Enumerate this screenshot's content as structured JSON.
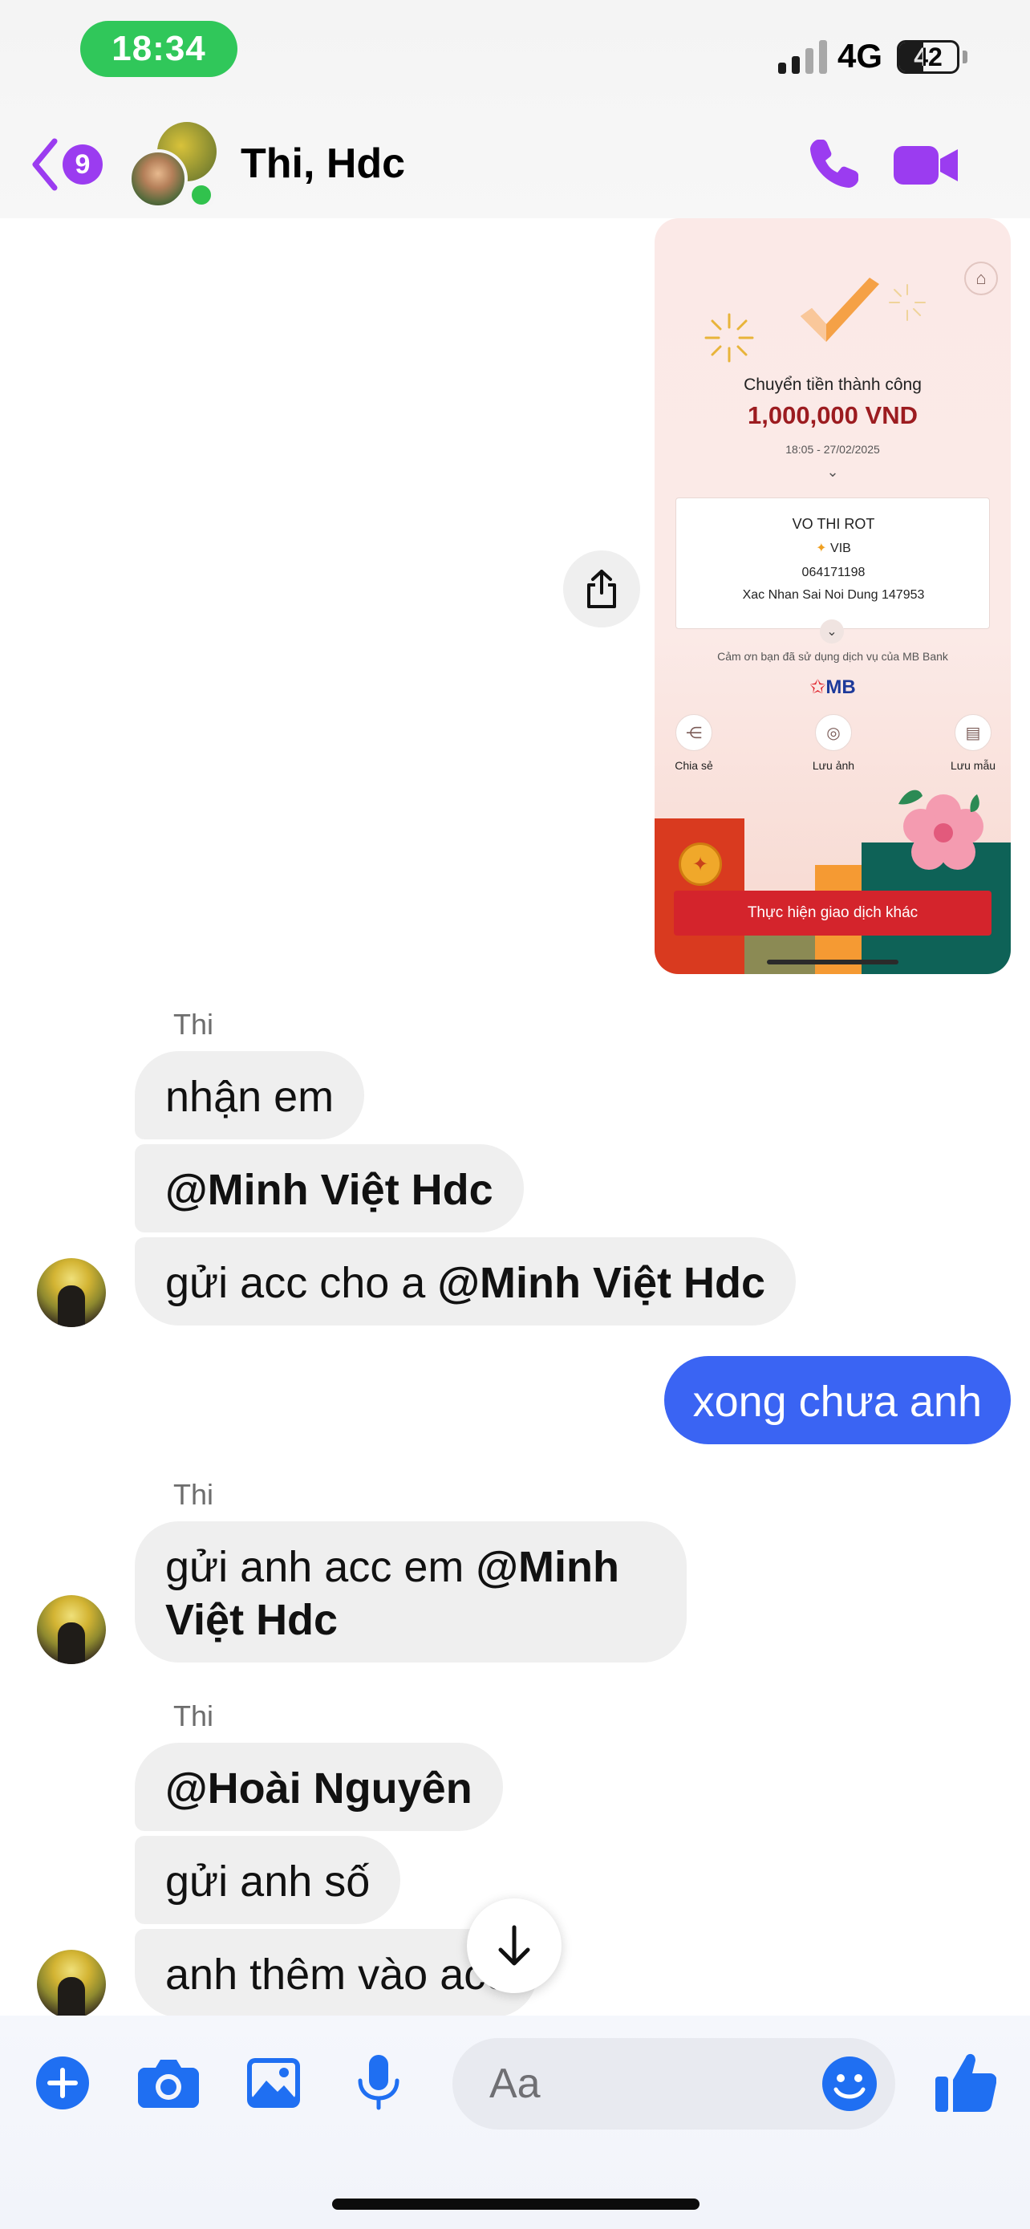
{
  "status_bar": {
    "time": "18:34",
    "network": "4G",
    "battery": "42",
    "battery_level": 0.42
  },
  "header": {
    "back_badge": "9",
    "title": "Thi, Hdc",
    "accent_color": "#9b3cf0",
    "icons": [
      "chevron-left-icon",
      "phone-icon",
      "video-camera-icon"
    ]
  },
  "receipt": {
    "title": "Chuyển tiền thành công",
    "amount": "1,000,000 VND",
    "datetime": "18:05 - 27/02/2025",
    "recipient_name": "VO THI ROT",
    "bank": "VIB",
    "account": "064171198",
    "note": "Xac Nhan Sai Noi Dung 147953",
    "thanks": "Cảm ơn bạn đã sử dụng dịch vụ của MB Bank",
    "brand": "MB",
    "actions": [
      "Chia sẻ",
      "Lưu ảnh",
      "Lưu mẫu"
    ],
    "cta": "Thực hiện giao dịch khác"
  },
  "messages": {
    "group1": {
      "sender": "Thi",
      "m1": "nhận em",
      "m2_mention": "@Minh Việt Hdc",
      "m3_text": "gửi acc cho a ",
      "m3_mention": "@Minh Việt Hdc"
    },
    "outgoing": "xong chưa anh",
    "outgoing_color": "#3a64f3",
    "group2": {
      "sender": "Thi",
      "m1_text": "gửi anh acc em ",
      "m1_mention": "@Minh Việt Hdc"
    },
    "group3": {
      "sender": "Thi",
      "m1_mention": "@Hoài Nguyên",
      "m2": "gửi anh số",
      "m3": "anh thêm vào acc"
    }
  },
  "composer": {
    "placeholder": "Aa",
    "tool_icons": [
      "plus-icon",
      "camera-icon",
      "gallery-icon",
      "microphone-icon"
    ],
    "accent_color": "#1f6ff2"
  }
}
